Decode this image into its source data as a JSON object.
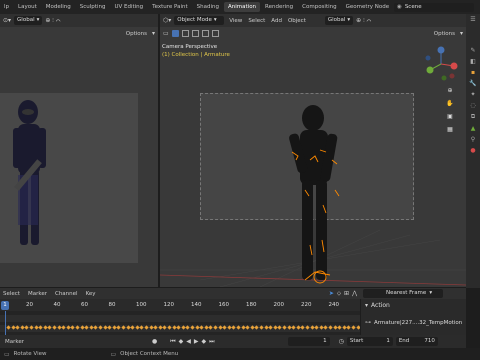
{
  "topbar": {
    "tabs": [
      "lp",
      "Layout",
      "Modeling",
      "Sculpting",
      "UV Editing",
      "Texture Paint",
      "Shading",
      "Animation",
      "Rendering",
      "Compositing",
      "Geometry Node"
    ],
    "active_tab": "Animation",
    "scene_label": "Scene"
  },
  "left_viewport": {
    "orientation": "Global",
    "options_label": "Options"
  },
  "right_viewport": {
    "mode": "Object Mode",
    "menus": [
      "View",
      "Select",
      "Add",
      "Object"
    ],
    "orientation": "Global",
    "options_label": "Options",
    "overlay_title": "Camera Perspective",
    "overlay_subtitle": "(1) Collection | Armature"
  },
  "timeline": {
    "menus": [
      "Select",
      "Marker",
      "Channel",
      "Key"
    ],
    "ticks": [
      "1",
      "20",
      "40",
      "60",
      "80",
      "100",
      "120",
      "140",
      "160",
      "180",
      "200",
      "220",
      "240"
    ],
    "interpolation": "Nearest Frame",
    "action_label": "Action",
    "action_name": "Armature|227....32_TempMotion",
    "marker_label": "Marker",
    "current_frame": "1",
    "start_label": "Start",
    "start_value": "1",
    "end_label": "End",
    "end_value": "710"
  },
  "statusbar": {
    "left": "Rotate View",
    "right": "Object Context Menu"
  },
  "colors": {
    "accent_blue": "#4772b3",
    "overlay_yellow": "#e2c84a",
    "keyframe_orange": "#e8a23a",
    "selection_orange": "#ff8a00"
  }
}
